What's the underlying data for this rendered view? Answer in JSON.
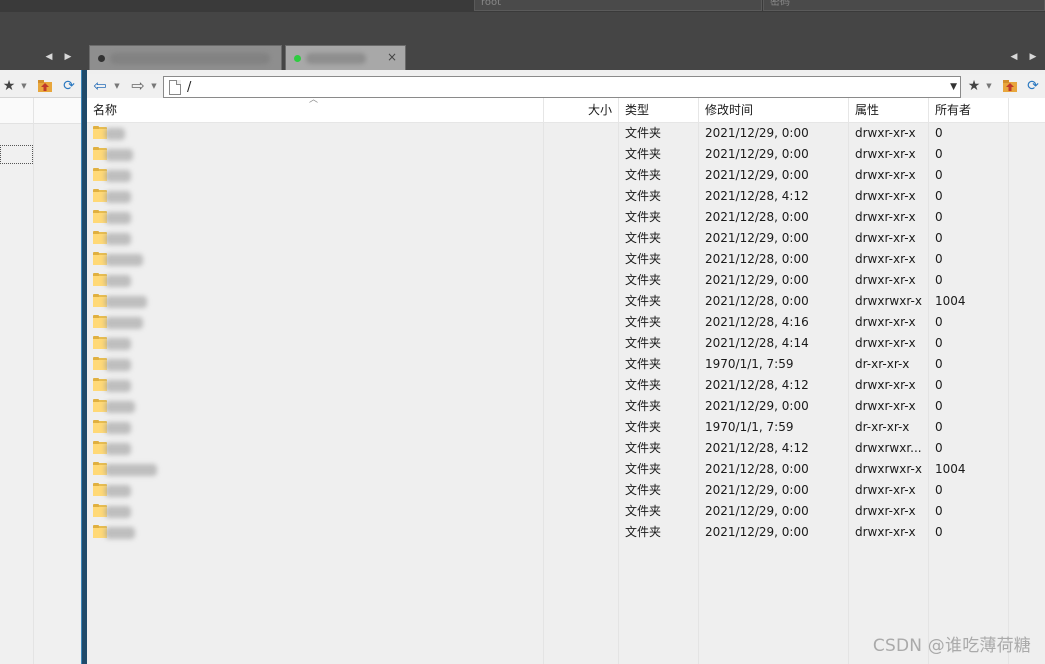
{
  "top": {
    "fields": [
      "root",
      "密码"
    ]
  },
  "tabs": [
    {
      "status_color": "#333333",
      "status": "dark"
    },
    {
      "status_color": "#2ecc40",
      "status": "green"
    }
  ],
  "toolbar": {
    "icons": [
      "star-icon",
      "folder-up-icon",
      "refresh-icon",
      "back-arrow-icon",
      "forward-arrow-icon"
    ]
  },
  "address": {
    "path": "/"
  },
  "columns": {
    "name": "名称",
    "size": "大小",
    "type": "类型",
    "modified": "修改时间",
    "attributes": "属性",
    "owner": "所有者"
  },
  "files": [
    {
      "type": "文件夹",
      "modified": "2021/12/29, 0:00",
      "attributes": "drwxr-xr-x",
      "owner": "0"
    },
    {
      "type": "文件夹",
      "modified": "2021/12/29, 0:00",
      "attributes": "drwxr-xr-x",
      "owner": "0"
    },
    {
      "type": "文件夹",
      "modified": "2021/12/29, 0:00",
      "attributes": "drwxr-xr-x",
      "owner": "0"
    },
    {
      "type": "文件夹",
      "modified": "2021/12/28, 4:12",
      "attributes": "drwxr-xr-x",
      "owner": "0"
    },
    {
      "type": "文件夹",
      "modified": "2021/12/28, 0:00",
      "attributes": "drwxr-xr-x",
      "owner": "0"
    },
    {
      "type": "文件夹",
      "modified": "2021/12/29, 0:00",
      "attributes": "drwxr-xr-x",
      "owner": "0"
    },
    {
      "type": "文件夹",
      "modified": "2021/12/28, 0:00",
      "attributes": "drwxr-xr-x",
      "owner": "0"
    },
    {
      "type": "文件夹",
      "modified": "2021/12/29, 0:00",
      "attributes": "drwxr-xr-x",
      "owner": "0"
    },
    {
      "type": "文件夹",
      "modified": "2021/12/28, 0:00",
      "attributes": "drwxrwxr-x",
      "owner": "1004"
    },
    {
      "type": "文件夹",
      "modified": "2021/12/28, 4:16",
      "attributes": "drwxr-xr-x",
      "owner": "0"
    },
    {
      "type": "文件夹",
      "modified": "2021/12/28, 4:14",
      "attributes": "drwxr-xr-x",
      "owner": "0"
    },
    {
      "type": "文件夹",
      "modified": "1970/1/1, 7:59",
      "attributes": "dr-xr-xr-x",
      "owner": "0"
    },
    {
      "type": "文件夹",
      "modified": "2021/12/28, 4:12",
      "attributes": "drwxr-xr-x",
      "owner": "0"
    },
    {
      "type": "文件夹",
      "modified": "2021/12/29, 0:00",
      "attributes": "drwxr-xr-x",
      "owner": "0"
    },
    {
      "type": "文件夹",
      "modified": "1970/1/1, 7:59",
      "attributes": "dr-xr-xr-x",
      "owner": "0"
    },
    {
      "type": "文件夹",
      "modified": "2021/12/28, 4:12",
      "attributes": "drwxrwxr...",
      "owner": "0"
    },
    {
      "type": "文件夹",
      "modified": "2021/12/28, 0:00",
      "attributes": "drwxrwxr-x",
      "owner": "1004"
    },
    {
      "type": "文件夹",
      "modified": "2021/12/29, 0:00",
      "attributes": "drwxr-xr-x",
      "owner": "0"
    },
    {
      "type": "文件夹",
      "modified": "2021/12/29, 0:00",
      "attributes": "drwxr-xr-x",
      "owner": "0"
    },
    {
      "type": "文件夹",
      "modified": "2021/12/29, 0:00",
      "attributes": "drwxr-xr-x",
      "owner": "0"
    }
  ],
  "watermark": "CSDN @谁吃薄荷糖",
  "colors": {
    "accent": "#3b85b8",
    "folder": "#ffd977",
    "tabbar": "#454545"
  }
}
